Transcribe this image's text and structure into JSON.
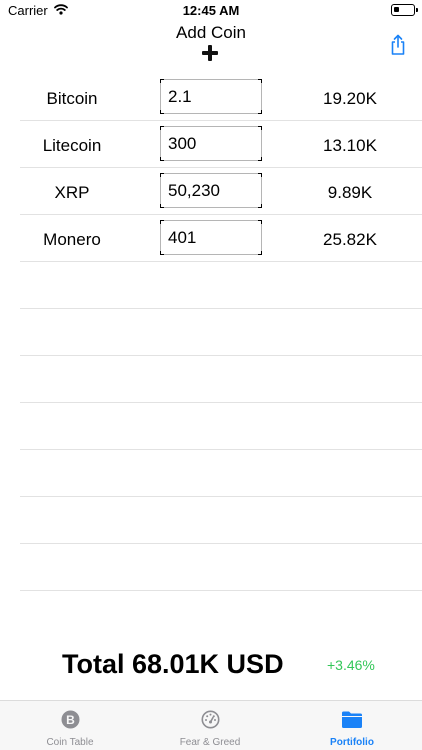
{
  "status_bar": {
    "carrier": "Carrier",
    "time": "12:45 AM"
  },
  "header": {
    "title": "Add Coin",
    "add_icon": "plus-icon",
    "share_icon": "share-icon"
  },
  "coins": [
    {
      "name": "Bitcoin",
      "amount": "2.1",
      "value": "19.20K"
    },
    {
      "name": "Litecoin",
      "amount": "300",
      "value": "13.10K"
    },
    {
      "name": "XRP",
      "amount": "50,230",
      "value": "9.89K"
    },
    {
      "name": "Monero",
      "amount": "401",
      "value": "25.82K"
    }
  ],
  "summary": {
    "total": "Total 68.01K USD",
    "change": "+3.46%"
  },
  "tabs": [
    {
      "label": "Coin Table",
      "icon": "bitcoin-icon",
      "active": false
    },
    {
      "label": "Fear & Greed",
      "icon": "gauge-icon",
      "active": false
    },
    {
      "label": "Portifolio",
      "icon": "folder-icon",
      "active": true
    }
  ],
  "colors": {
    "accent": "#1a82f7",
    "positive": "#34c759",
    "inactive": "#8e8e93"
  }
}
